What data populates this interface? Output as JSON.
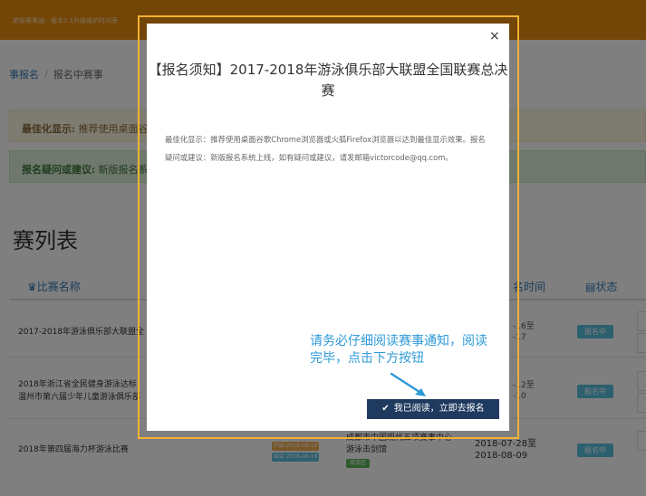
{
  "topbar": {
    "notice": "救智赛事通：版本2.1升级维护时间表"
  },
  "breadcrumb": {
    "root": "事报名",
    "separator": "/",
    "current": "报名中赛事"
  },
  "alerts": {
    "warning": {
      "label": "最佳化显示:",
      "text": "推荐使用桌面谷歌"
    },
    "success": {
      "label": "报名疑问或建议:",
      "text": "新版报名系统"
    }
  },
  "list": {
    "title": "赛列表",
    "columns": {
      "name_icon": "♛",
      "name": "比赛名称",
      "time": "名时间",
      "status_icon": "▤",
      "status": "状态"
    },
    "rows": [
      {
        "name": "2017-2018年游泳俱乐部大联盟全",
        "time_start": "-16至",
        "time_end": "-17",
        "status": "报名中"
      },
      {
        "name_line1": "2018年浙江省全民健身游泳达标",
        "name_line2": "温州市第六届少年儿童游泳俱乐部",
        "time_start": "-12至",
        "time_end": "-10",
        "status": "报名中"
      },
      {
        "name": "2018年第四届海力杯游泳比赛",
        "date_start": "开始:2018-08-19",
        "date_end": "结束:2018-08-19",
        "venue_line1": "成都市中国现代五项赛事中心",
        "venue_line2": "游泳击剑馆",
        "venue_tag": "双流区",
        "time_start": "2018-07-28至",
        "time_end": "2018-08-09",
        "status": "报名中"
      }
    ]
  },
  "modal": {
    "title": "【报名须知】2017-2018年游泳俱乐部大联盟全国联赛总决赛",
    "body": "最佳化显示：推荐使用桌面谷歌Chrome浏览器或火狐Firefox浏览器以达到最佳显示效果。报名疑问或建议：新版报名系统上线，如有疑问或建议，请发邮箱victorcode@qq.com。",
    "hint": "请务必仔细阅读赛事通知，阅读完毕，点击下方按钮",
    "confirm_label": "我已阅读，立即去报名",
    "close": "×"
  },
  "colors": {
    "topbar": "#e68a0f",
    "accent": "#337ab7",
    "badge": "#5bc0de",
    "button": "#1f3a5f",
    "hint": "#2e9ad8",
    "frame": "#f2b233"
  }
}
